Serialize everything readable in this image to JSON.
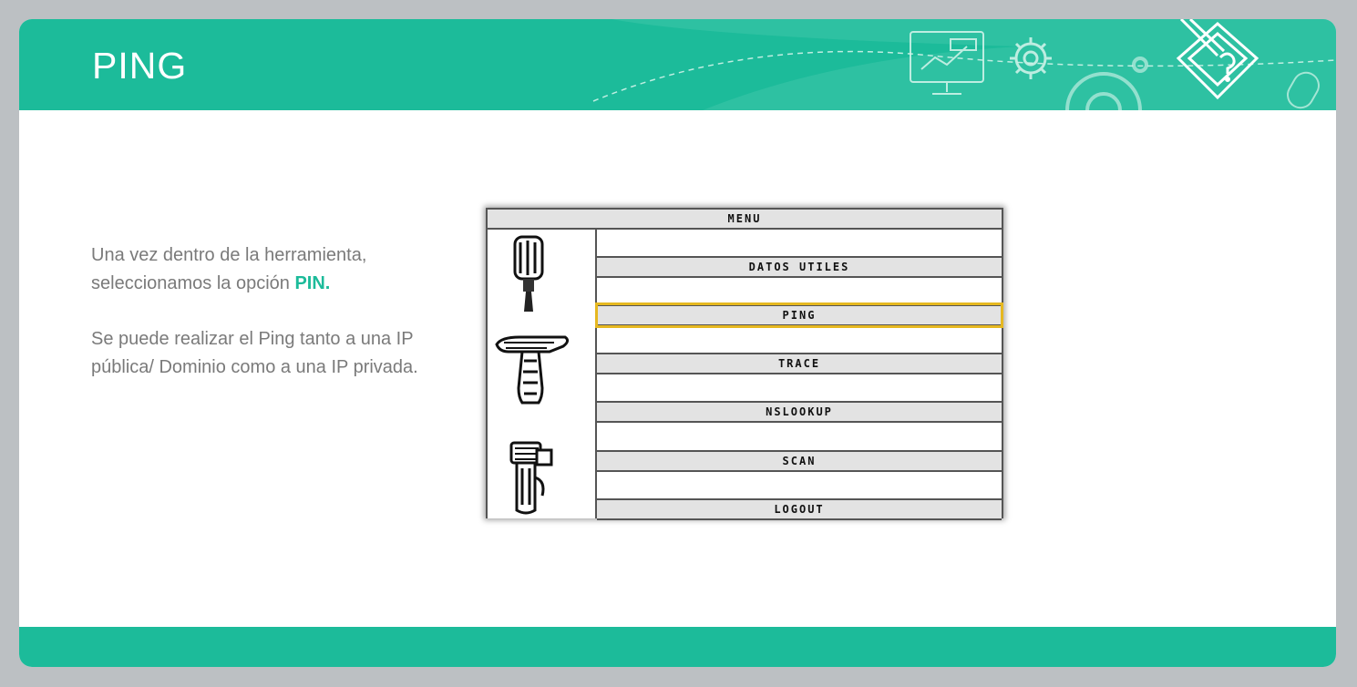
{
  "slide": {
    "title": "PING",
    "accent_color": "#1cbb9a",
    "header_icons": [
      "presentation-board-icon",
      "gear-icon",
      "large-gear-icon",
      "pencil-diamond-icon",
      "mouse-icon"
    ]
  },
  "body": {
    "paragraph1_prefix": "Una vez dentro de la herramienta, seleccionamos la opción ",
    "paragraph1_highlight": "PIN.",
    "paragraph2": "Se puede realizar el Ping tanto a una IP pública/ Dominio como a una IP privada."
  },
  "menu": {
    "header": "MENU",
    "items": [
      {
        "label": "DATOS UTILES",
        "selected": false
      },
      {
        "label": "PING",
        "selected": true
      },
      {
        "label": "TRACE",
        "selected": false
      },
      {
        "label": "NSLOOKUP",
        "selected": false
      },
      {
        "label": "SCAN",
        "selected": false
      },
      {
        "label": "LOGOUT",
        "selected": false
      }
    ],
    "tool_icons": [
      "screwdriver-icon",
      "hammer-icon",
      "wrench-icon"
    ],
    "selection_color": "#e6b820"
  }
}
